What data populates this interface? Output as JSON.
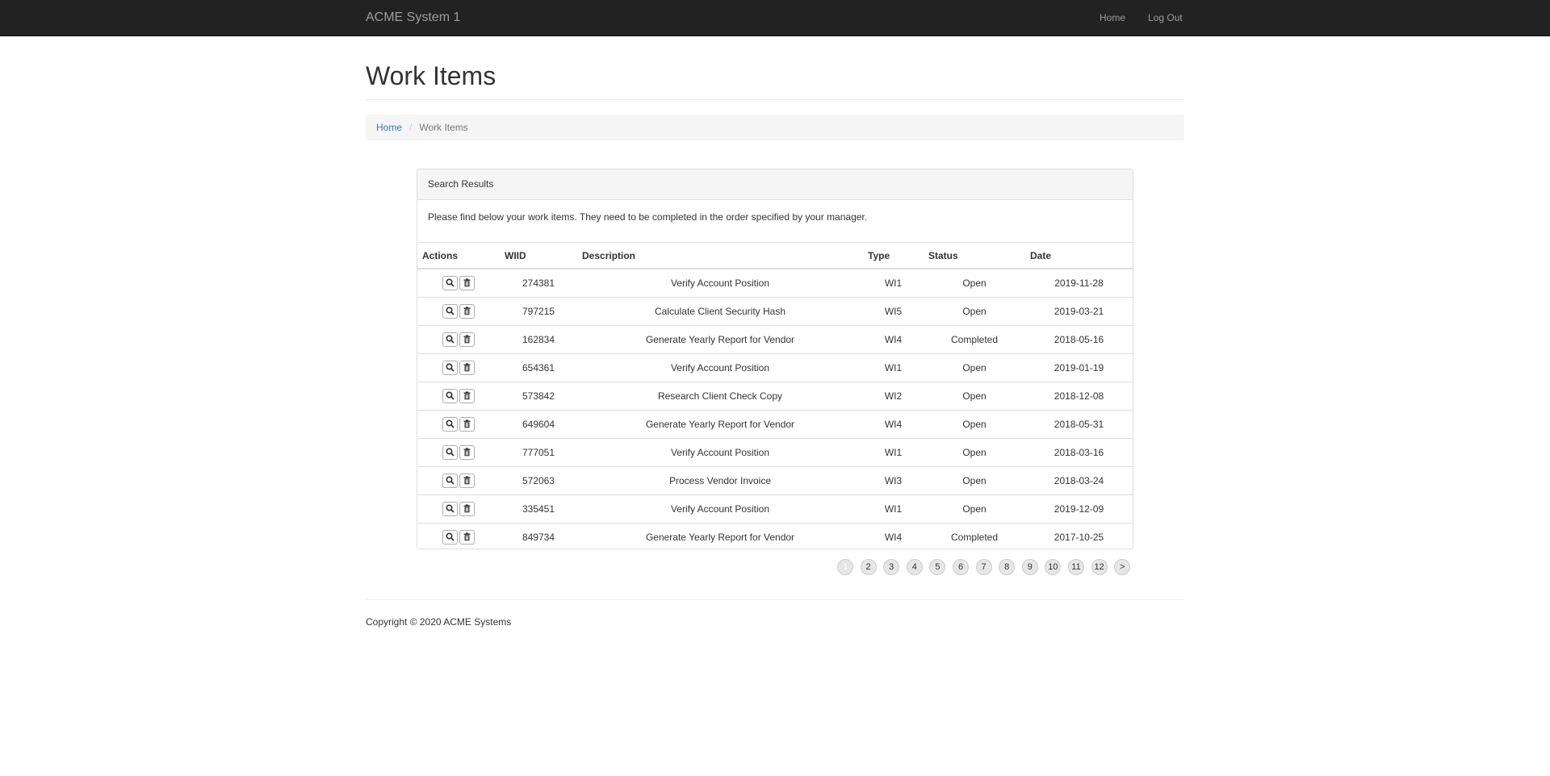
{
  "navbar": {
    "brand": "ACME System 1",
    "links": {
      "home": "Home",
      "logout": "Log Out"
    }
  },
  "page": {
    "title": "Work Items"
  },
  "breadcrumb": {
    "home": "Home",
    "separator": "/",
    "current": "Work Items"
  },
  "panel": {
    "heading": "Search Results",
    "intro": "Please find below your work items. They need to be completed in the order specified by your manager."
  },
  "table": {
    "headers": {
      "actions": "Actions",
      "wiid": "WIID",
      "description": "Description",
      "type": "Type",
      "status": "Status",
      "date": "Date"
    },
    "rows": [
      {
        "wiid": "274381",
        "description": "Verify Account Position",
        "type": "WI1",
        "status": "Open",
        "date": "2019-11-28"
      },
      {
        "wiid": "797215",
        "description": "Calculate Client Security Hash",
        "type": "WI5",
        "status": "Open",
        "date": "2019-03-21"
      },
      {
        "wiid": "162834",
        "description": "Generate Yearly Report for Vendor",
        "type": "WI4",
        "status": "Completed",
        "date": "2018-05-16"
      },
      {
        "wiid": "654361",
        "description": "Verify Account Position",
        "type": "WI1",
        "status": "Open",
        "date": "2019-01-19"
      },
      {
        "wiid": "573842",
        "description": "Research Client Check Copy",
        "type": "WI2",
        "status": "Open",
        "date": "2018-12-08"
      },
      {
        "wiid": "649604",
        "description": "Generate Yearly Report for Vendor",
        "type": "WI4",
        "status": "Open",
        "date": "2018-05-31"
      },
      {
        "wiid": "777051",
        "description": "Verify Account Position",
        "type": "WI1",
        "status": "Open",
        "date": "2018-03-16"
      },
      {
        "wiid": "572063",
        "description": "Process Vendor Invoice",
        "type": "WI3",
        "status": "Open",
        "date": "2018-03-24"
      },
      {
        "wiid": "335451",
        "description": "Verify Account Position",
        "type": "WI1",
        "status": "Open",
        "date": "2019-12-09"
      },
      {
        "wiid": "849734",
        "description": "Generate Yearly Report for Vendor",
        "type": "WI4",
        "status": "Completed",
        "date": "2017-10-25"
      }
    ],
    "row_actions": [
      "search-icon",
      "trash-icon"
    ]
  },
  "pagination": {
    "pages": [
      "1",
      "2",
      "3",
      "4",
      "5",
      "6",
      "7",
      "8",
      "9",
      "10",
      "11",
      "12",
      ">"
    ],
    "current": "1"
  },
  "footer": {
    "copyright": "Copyright © 2020 ACME Systems"
  },
  "colors": {
    "navbar_bg": "#222222",
    "navbar_text": "#9d9d9d",
    "link": "#337ab7",
    "panel_heading_bg": "#f5f5f5",
    "border": "#dddddd"
  }
}
